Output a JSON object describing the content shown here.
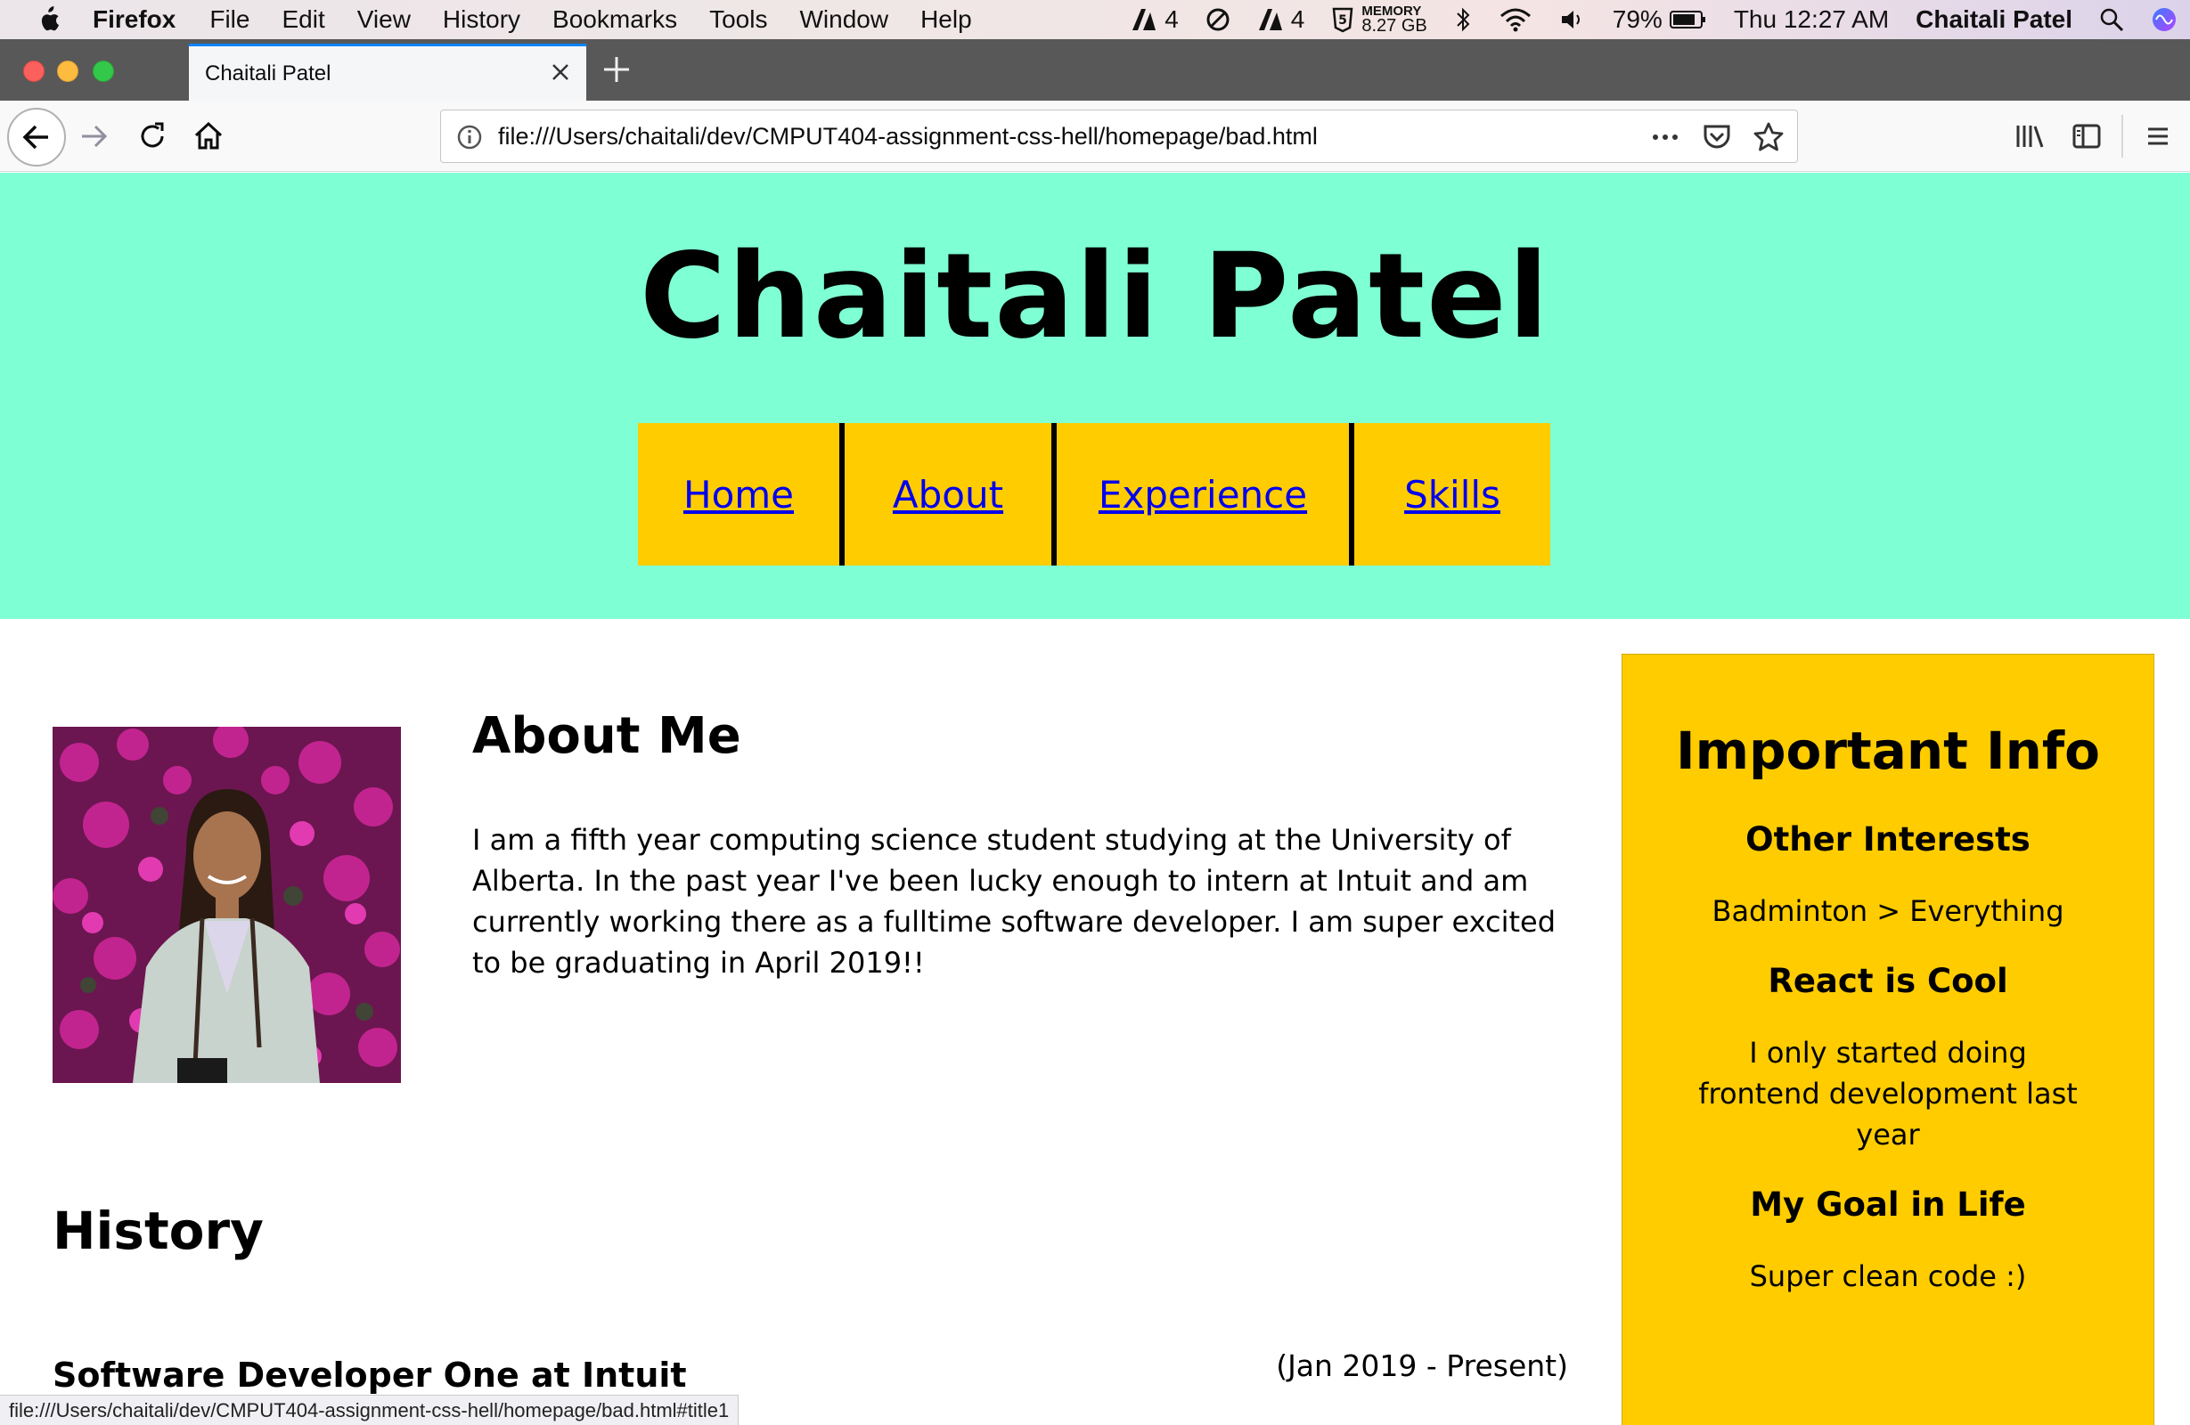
{
  "menubar": {
    "app": "Firefox",
    "menus": [
      "File",
      "Edit",
      "View",
      "History",
      "Bookmarks",
      "Tools",
      "Window",
      "Help"
    ],
    "status": {
      "adobe1_count": "4",
      "adobe2_count": "4",
      "memory_label": "MEMORY",
      "memory_value": "8.27 GB",
      "battery": "79%",
      "clock": "Thu 12:27 AM",
      "user": "Chaitali Patel"
    }
  },
  "browser": {
    "tab_title": "Chaitali Patel",
    "url": "file:///Users/chaitali/dev/CMPUT404-assignment-css-hell/homepage/bad.html",
    "status_url": "file:///Users/chaitali/dev/CMPUT404-assignment-css-hell/homepage/bad.html#title1"
  },
  "site": {
    "title": "Chaitali Patel",
    "nav": [
      "Home",
      "About",
      "Experience",
      "Skills"
    ],
    "about": {
      "heading": "About Me",
      "text": "I am a fifth year computing science student studying at the University of Alberta. In the past year I've been lucky enough to intern at Intuit and am currently working there as a fulltime software developer. I am super excited to be graduating in April 2019!!"
    },
    "history": {
      "heading": "History",
      "job_title": "Software Developer One at Intuit",
      "job_dates": "(Jan 2019 - Present)"
    },
    "sidebar": {
      "heading": "Important Info",
      "items": [
        {
          "title": "Other Interests",
          "text": "Badminton > Everything"
        },
        {
          "title": "React is Cool",
          "text": "I only started doing frontend development last year"
        },
        {
          "title": "My Goal in Life",
          "text": "Super clean code :)"
        }
      ]
    }
  },
  "colors": {
    "hero_bg": "#7fffd4",
    "nav_bg": "#ffcc00",
    "sidebar_bg": "#ffcc00",
    "link": "#0000ee"
  }
}
